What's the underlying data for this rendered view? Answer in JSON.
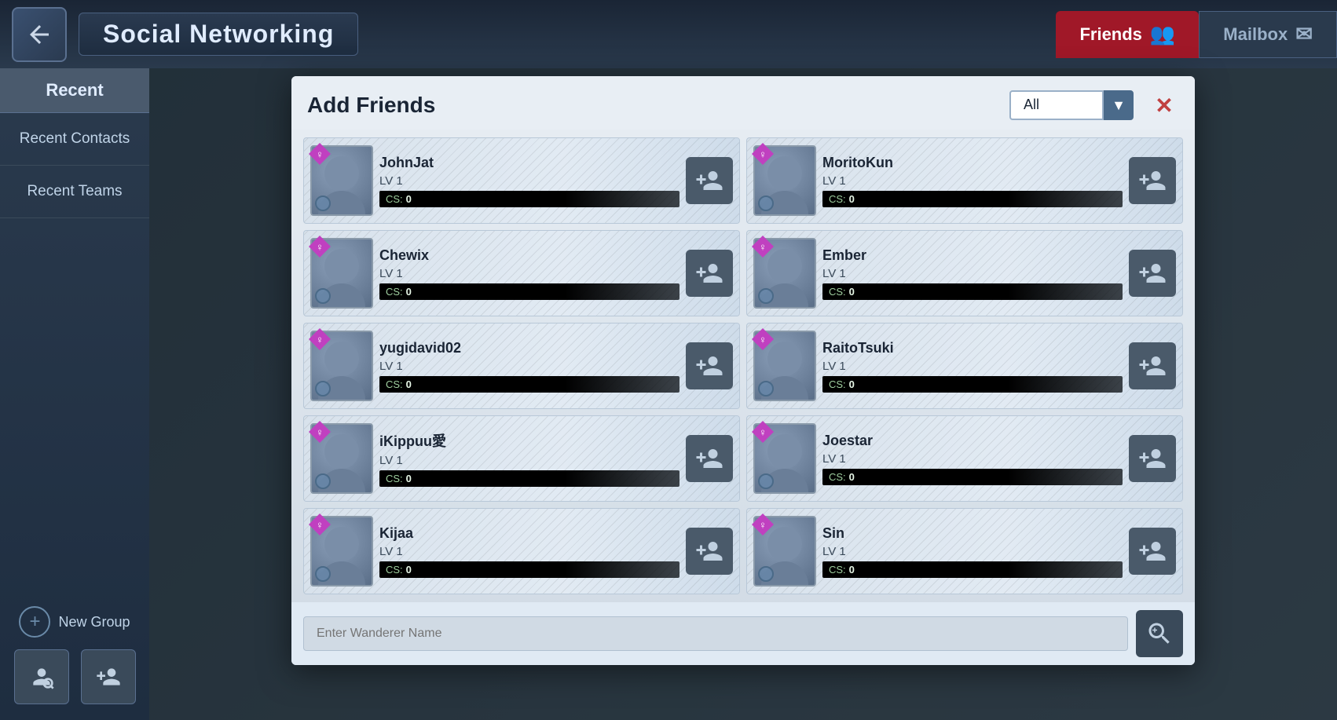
{
  "app": {
    "title": "Social Networking",
    "back_button": "←"
  },
  "topbar": {
    "friends_tab": "Friends",
    "mailbox_tab": "Mailbox"
  },
  "sidebar": {
    "recent_label": "Recent",
    "recent_contacts": "Recent Contacts",
    "recent_teams": "Recent Teams",
    "new_group": "New Group"
  },
  "modal": {
    "title": "Add Friends",
    "filter_value": "All",
    "filter_placeholder": "All",
    "search_placeholder": "Enter Wanderer Name",
    "close_label": "✕",
    "dropdown_arrow": "▼"
  },
  "players": [
    {
      "name": "JohnJat",
      "level": "LV  1",
      "cs": "0",
      "gender": "♀"
    },
    {
      "name": "MoritoKun",
      "level": "LV  1",
      "cs": "0",
      "gender": "♀"
    },
    {
      "name": "Chewix",
      "level": "LV  1",
      "cs": "0",
      "gender": "♀"
    },
    {
      "name": "Ember",
      "level": "LV  1",
      "cs": "0",
      "gender": "♀"
    },
    {
      "name": "yugidavid02",
      "level": "LV  1",
      "cs": "0",
      "gender": "♀"
    },
    {
      "name": "RaitoTsuki",
      "level": "LV  1",
      "cs": "0",
      "gender": "♀"
    },
    {
      "name": "iKippuu愛",
      "level": "LV  1",
      "cs": "0",
      "gender": "♀"
    },
    {
      "name": "Joestar",
      "level": "LV  1",
      "cs": "0",
      "gender": "♀"
    },
    {
      "name": "Kijaa",
      "level": "LV  1",
      "cs": "0",
      "gender": "♀"
    },
    {
      "name": "Sin",
      "level": "LV  1",
      "cs": "0",
      "gender": "♀"
    }
  ],
  "labels": {
    "cs": "CS:",
    "lv_prefix": "LV"
  }
}
